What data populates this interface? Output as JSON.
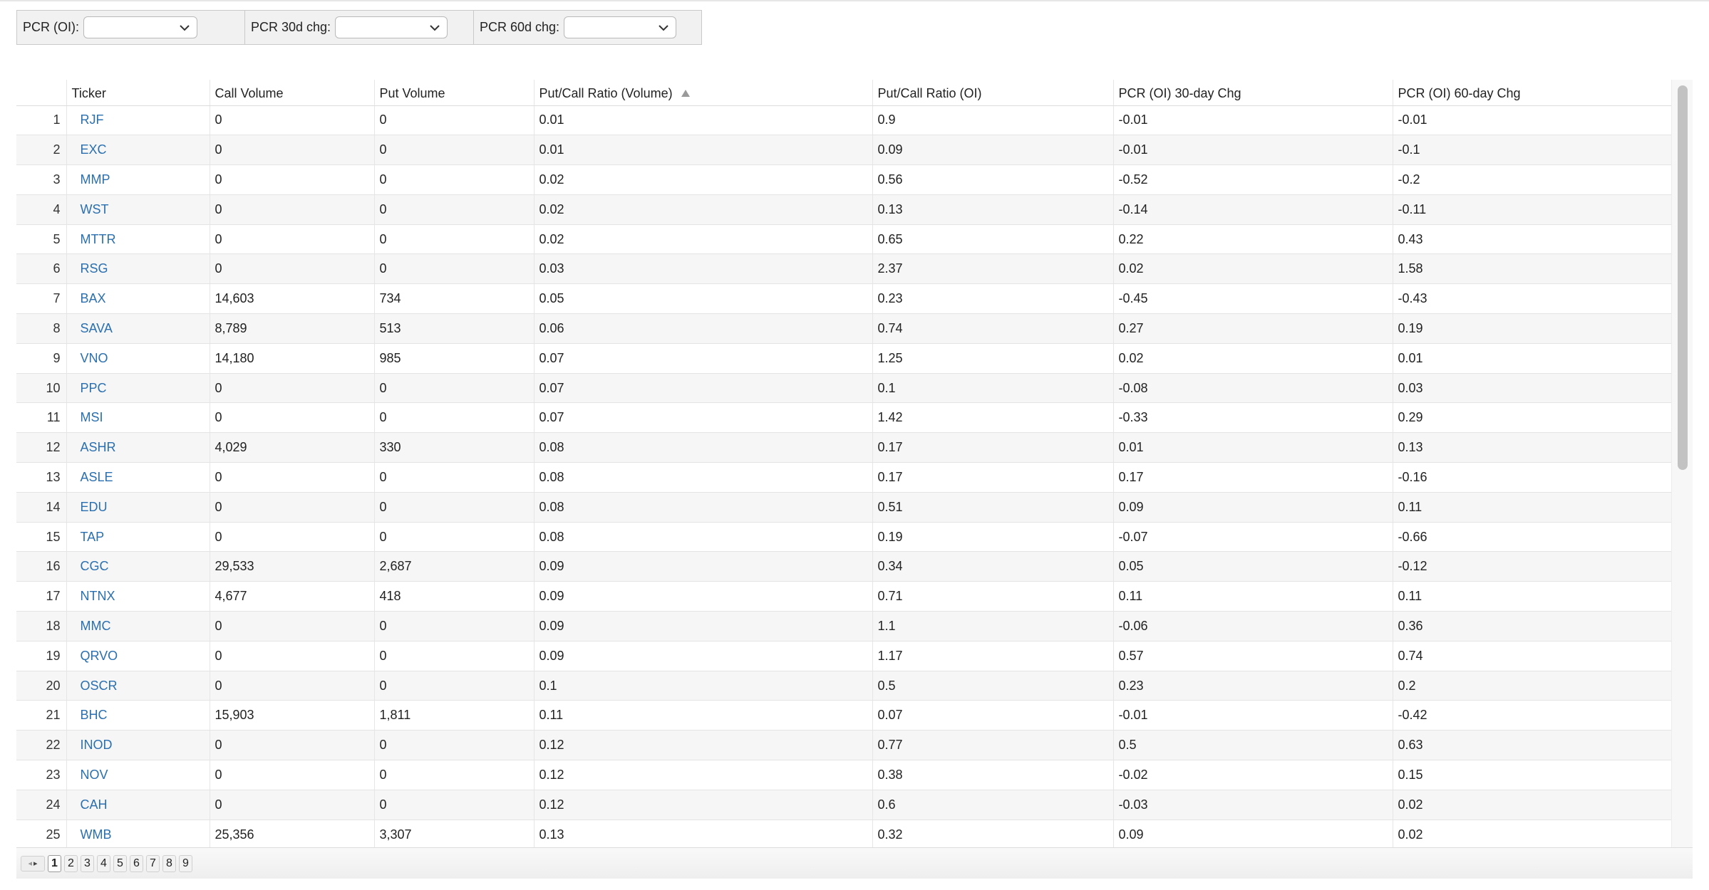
{
  "filters": [
    {
      "label": "PCR (OI):",
      "value": ""
    },
    {
      "label": "PCR 30d chg:",
      "value": ""
    },
    {
      "label": "PCR 60d chg:",
      "value": ""
    }
  ],
  "table": {
    "columns": [
      "",
      "Ticker",
      "Call Volume",
      "Put Volume",
      "Put/Call Ratio (Volume)",
      "Put/Call Ratio (OI)",
      "PCR (OI) 30-day Chg",
      "PCR (OI) 60-day Chg"
    ],
    "sorted_column": "Put/Call Ratio (Volume)",
    "sort_direction": "ascending",
    "rows": [
      [
        "1",
        "RJF",
        "0",
        "0",
        "0.01",
        "0.9",
        "-0.01",
        "-0.01"
      ],
      [
        "2",
        "EXC",
        "0",
        "0",
        "0.01",
        "0.09",
        "-0.01",
        "-0.1"
      ],
      [
        "3",
        "MMP",
        "0",
        "0",
        "0.02",
        "0.56",
        "-0.52",
        "-0.2"
      ],
      [
        "4",
        "WST",
        "0",
        "0",
        "0.02",
        "0.13",
        "-0.14",
        "-0.11"
      ],
      [
        "5",
        "MTTR",
        "0",
        "0",
        "0.02",
        "0.65",
        "0.22",
        "0.43"
      ],
      [
        "6",
        "RSG",
        "0",
        "0",
        "0.03",
        "2.37",
        "0.02",
        "1.58"
      ],
      [
        "7",
        "BAX",
        "14,603",
        "734",
        "0.05",
        "0.23",
        "-0.45",
        "-0.43"
      ],
      [
        "8",
        "SAVA",
        "8,789",
        "513",
        "0.06",
        "0.74",
        "0.27",
        "0.19"
      ],
      [
        "9",
        "VNO",
        "14,180",
        "985",
        "0.07",
        "1.25",
        "0.02",
        "0.01"
      ],
      [
        "10",
        "PPC",
        "0",
        "0",
        "0.07",
        "0.1",
        "-0.08",
        "0.03"
      ],
      [
        "11",
        "MSI",
        "0",
        "0",
        "0.07",
        "1.42",
        "-0.33",
        "0.29"
      ],
      [
        "12",
        "ASHR",
        "4,029",
        "330",
        "0.08",
        "0.17",
        "0.01",
        "0.13"
      ],
      [
        "13",
        "ASLE",
        "0",
        "0",
        "0.08",
        "0.17",
        "0.17",
        "-0.16"
      ],
      [
        "14",
        "EDU",
        "0",
        "0",
        "0.08",
        "0.51",
        "0.09",
        "0.11"
      ],
      [
        "15",
        "TAP",
        "0",
        "0",
        "0.08",
        "0.19",
        "-0.07",
        "-0.66"
      ],
      [
        "16",
        "CGC",
        "29,533",
        "2,687",
        "0.09",
        "0.34",
        "0.05",
        "-0.12"
      ],
      [
        "17",
        "NTNX",
        "4,677",
        "418",
        "0.09",
        "0.71",
        "0.11",
        "0.11"
      ],
      [
        "18",
        "MMC",
        "0",
        "0",
        "0.09",
        "1.1",
        "-0.06",
        "0.36"
      ],
      [
        "19",
        "QRVO",
        "0",
        "0",
        "0.09",
        "1.17",
        "0.57",
        "0.74"
      ],
      [
        "20",
        "OSCR",
        "0",
        "0",
        "0.1",
        "0.5",
        "0.23",
        "0.2"
      ],
      [
        "21",
        "BHC",
        "15,903",
        "1,811",
        "0.11",
        "0.07",
        "-0.01",
        "-0.42"
      ],
      [
        "22",
        "INOD",
        "0",
        "0",
        "0.12",
        "0.77",
        "0.5",
        "0.63"
      ],
      [
        "23",
        "NOV",
        "0",
        "0",
        "0.12",
        "0.38",
        "-0.02",
        "0.15"
      ],
      [
        "24",
        "CAH",
        "0",
        "0",
        "0.12",
        "0.6",
        "-0.03",
        "0.02"
      ],
      [
        "25",
        "WMB",
        "25,356",
        "3,307",
        "0.13",
        "0.32",
        "0.09",
        "0.02"
      ]
    ]
  },
  "pager": {
    "current": "1",
    "pages": [
      "1",
      "2",
      "3",
      "4",
      "5",
      "6",
      "7",
      "8",
      "9"
    ]
  },
  "colors": {
    "link": "#2a6fb0",
    "row_alt": "#f6f6f6",
    "filter_bg": "#f1f1f1"
  }
}
